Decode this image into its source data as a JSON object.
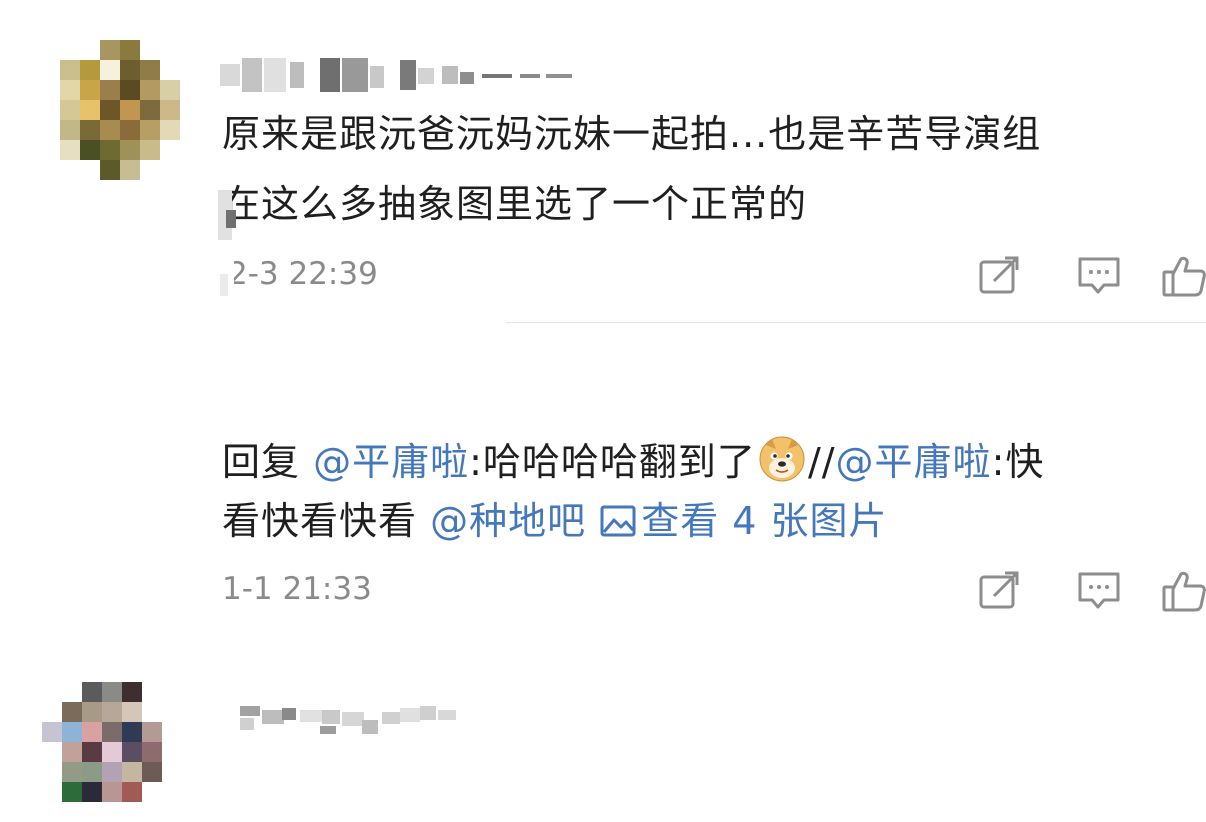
{
  "comments": [
    {
      "username_censored": true,
      "text_lines": [
        "原来是跟沅爸沅妈沅妹一起拍...也是辛苦导演组",
        "在这么多抽象图里选了一个正常的"
      ],
      "time": "2-3 22:39",
      "actions": [
        {
          "icon": "share-icon",
          "label": "share"
        },
        {
          "icon": "comment-icon",
          "label": "comment"
        },
        {
          "icon": "like-icon",
          "label": "like"
        }
      ]
    },
    {
      "username_censored": true,
      "reply_prefix": "回复",
      "mention_1": "@平庸啦",
      "reply_text": ":哈哈哈哈翻到了",
      "emoji": "doge-emoji",
      "repost_sep": "//",
      "mention_2": "@平庸啦",
      "reply_text_2": ":快",
      "line2_text": "看快看快看",
      "mention_3": "@种地吧",
      "image_link_icon": "image-icon",
      "image_link_text": "查看 4 张图片",
      "time": "1-1 21:33",
      "actions": [
        {
          "icon": "share-icon",
          "label": "share"
        },
        {
          "icon": "comment-icon",
          "label": "comment"
        },
        {
          "icon": "like-icon",
          "label": "like"
        }
      ]
    }
  ],
  "colors": {
    "link": "#4477bb",
    "text": "#1f1f1f",
    "meta": "#8a8a8a",
    "icon": "#8d8d8d",
    "divider": "#e6e6e6"
  }
}
